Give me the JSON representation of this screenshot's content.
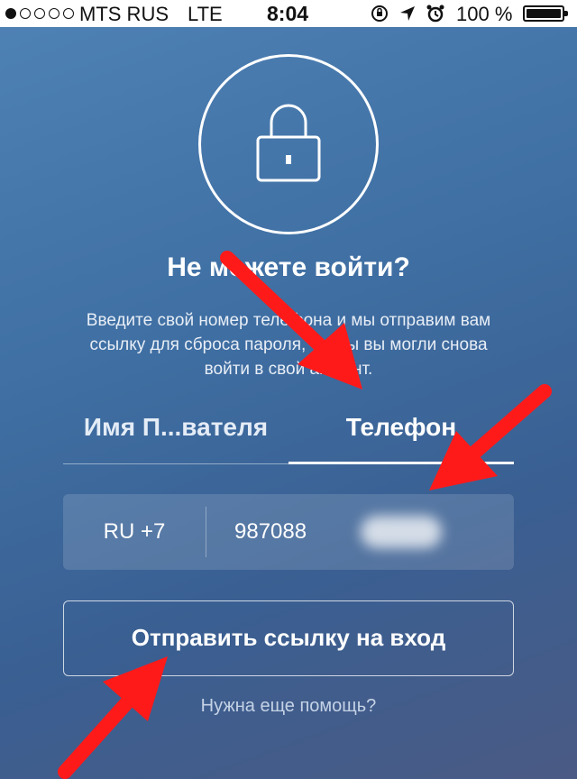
{
  "status_bar": {
    "carrier": "MTS RUS",
    "network": "LTE",
    "time": "8:04",
    "battery": "100 %",
    "icons": [
      "lock-rotation-icon",
      "location-arrow-icon",
      "alarm-clock-icon",
      "battery-icon"
    ]
  },
  "header": {
    "lock_icon": "lock-icon",
    "title": "Не можете войти?",
    "description": "Введите свой номер телефона и мы отправим вам ссылку для сброса пароля, чтобы вы могли снова войти в свой аккаунт."
  },
  "tabs": [
    {
      "label": "Имя П...вателя",
      "active": false
    },
    {
      "label": "Телефон",
      "active": true
    }
  ],
  "phone_field": {
    "country_code": "RU +7",
    "value": "987088"
  },
  "actions": {
    "send_button_label": "Отправить ссылку на вход",
    "help_link": "Нужна еще помощь?"
  },
  "annotations": {
    "arrow_color": "#ff1a1a"
  }
}
